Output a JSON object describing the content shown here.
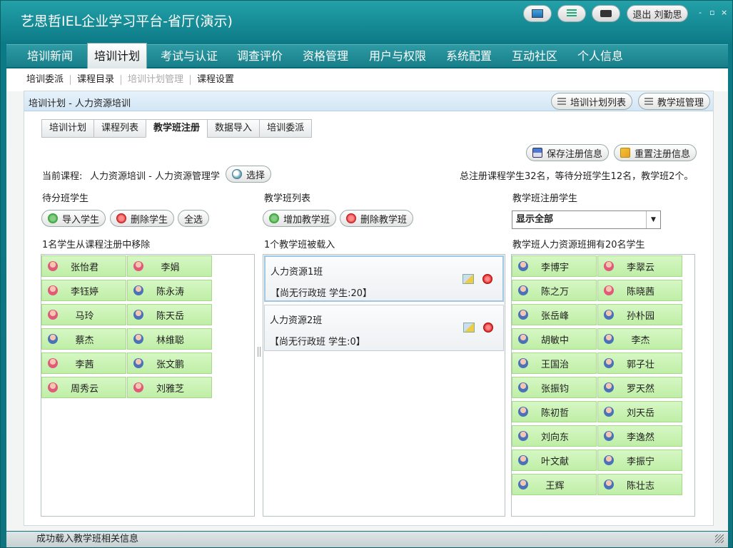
{
  "app": {
    "title": "艺思哲IEL企业学习平台-省厅(演示)",
    "logout_label": "退出 刘勤思",
    "window_controls": [
      "-",
      "▫",
      "×"
    ]
  },
  "menu": [
    {
      "label": "培训新闻"
    },
    {
      "label": "培训计划",
      "active": true
    },
    {
      "label": "考试与认证"
    },
    {
      "label": "调查评价"
    },
    {
      "label": "资格管理"
    },
    {
      "label": "用户与权限"
    },
    {
      "label": "系统配置"
    },
    {
      "label": "互动社区"
    },
    {
      "label": "个人信息"
    }
  ],
  "subnav": [
    {
      "label": "培训委派"
    },
    {
      "label": "课程目录"
    },
    {
      "label": "培训计划管理",
      "disabled": true
    },
    {
      "label": "课程设置"
    }
  ],
  "panel": {
    "title": "培训计划 - 人力资源培训",
    "plan_list_button": "培训计划列表",
    "class_mgmt_button": "教学班管理"
  },
  "tabs": [
    {
      "label": "培训计划"
    },
    {
      "label": "课程列表"
    },
    {
      "label": "教学班注册",
      "active": true
    },
    {
      "label": "数据导入"
    },
    {
      "label": "培训委派"
    }
  ],
  "actions": {
    "save": "保存注册信息",
    "reset": "重置注册信息"
  },
  "course": {
    "label": "当前课程:",
    "value": "人力资源培训 - 人力资源管理学",
    "select_button": "选择",
    "summary": "总注册课程学生32名，等待分班学生12名，教学班2个。"
  },
  "pending": {
    "title": "待分班学生",
    "import_button": "导入学生",
    "delete_button": "删除学生",
    "select_all_button": "全选",
    "message": "1名学生从课程注册中移除",
    "students": [
      {
        "name": "张怡君",
        "gender": "f"
      },
      {
        "name": "李娟",
        "gender": "f"
      },
      {
        "name": "李钰婷",
        "gender": "f"
      },
      {
        "name": "陈永涛",
        "gender": "m"
      },
      {
        "name": "马玲",
        "gender": "f"
      },
      {
        "name": "陈天岳",
        "gender": "m"
      },
      {
        "name": "蔡杰",
        "gender": "m"
      },
      {
        "name": "林维聪",
        "gender": "m"
      },
      {
        "name": "李茜",
        "gender": "f"
      },
      {
        "name": "张文鹏",
        "gender": "m"
      },
      {
        "name": "周秀云",
        "gender": "f"
      },
      {
        "name": "刘雅芝",
        "gender": "f"
      }
    ]
  },
  "classes": {
    "title": "教学班列表",
    "add_button": "增加教学班",
    "delete_button": "删除教学班",
    "message": "1个教学班被载入",
    "items": [
      {
        "name": "人力资源1班",
        "status": "【尚无行政班  学生:20】",
        "selected": true
      },
      {
        "name": "人力资源2班",
        "status": "【尚无行政班  学生:0】",
        "selected": false
      }
    ]
  },
  "registered": {
    "title": "教学班注册学生",
    "filter_value": "显示全部",
    "message": "教学班人力资源班拥有20名学生",
    "students": [
      {
        "name": "李博宇",
        "gender": "m"
      },
      {
        "name": "李翠云",
        "gender": "f"
      },
      {
        "name": "陈之万",
        "gender": "m"
      },
      {
        "name": "陈晓茜",
        "gender": "f"
      },
      {
        "name": "张岳峰",
        "gender": "m"
      },
      {
        "name": "孙朴园",
        "gender": "m"
      },
      {
        "name": "胡敏中",
        "gender": "m"
      },
      {
        "name": "李杰",
        "gender": "m"
      },
      {
        "name": "王国治",
        "gender": "m"
      },
      {
        "name": "郭子壮",
        "gender": "m"
      },
      {
        "name": "张振钧",
        "gender": "m"
      },
      {
        "name": "罗天然",
        "gender": "m"
      },
      {
        "name": "陈初哲",
        "gender": "m"
      },
      {
        "name": "刘天岳",
        "gender": "m"
      },
      {
        "name": "刘向东",
        "gender": "m"
      },
      {
        "name": "李逸然",
        "gender": "m"
      },
      {
        "name": "叶文献",
        "gender": "m"
      },
      {
        "name": "李振宁",
        "gender": "m"
      },
      {
        "name": "王辉",
        "gender": "m"
      },
      {
        "name": "陈壮志",
        "gender": "m"
      }
    ]
  },
  "status_bar": {
    "text": "成功载入教学班相关信息"
  }
}
